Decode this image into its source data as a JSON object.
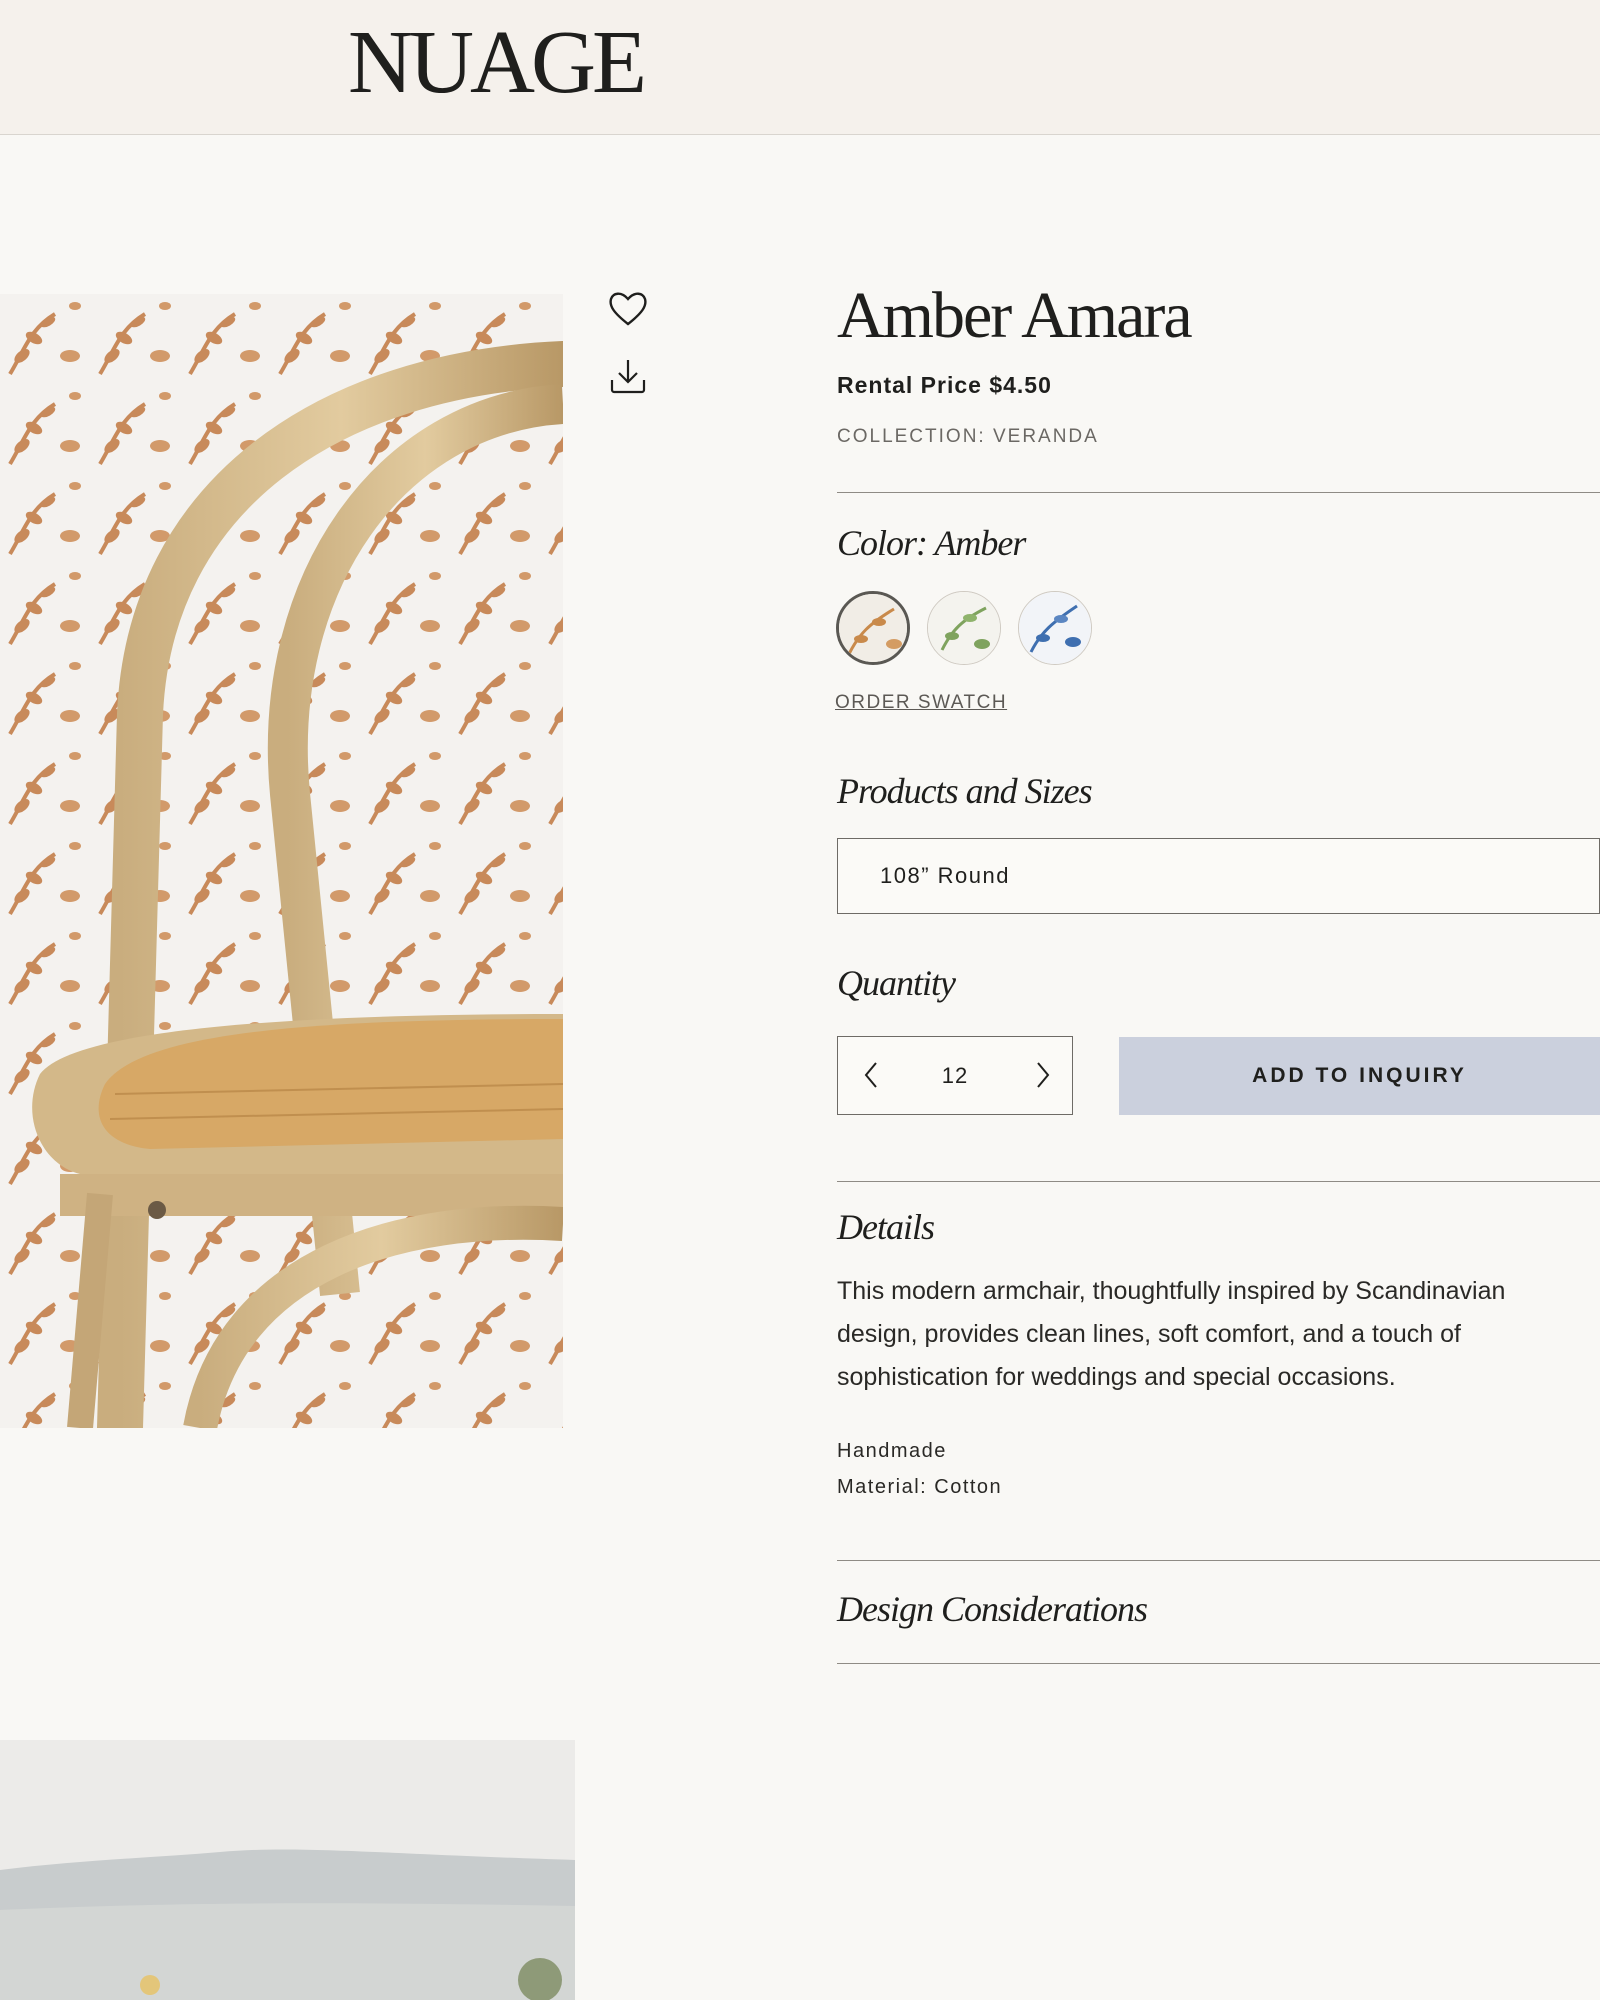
{
  "header": {
    "logo": "NUAGE"
  },
  "product": {
    "title": "Amber Amara",
    "price": "Rental Price $4.50",
    "collection": "COLLECTION: VERANDA"
  },
  "color": {
    "label": "Color: Amber",
    "swatches": [
      {
        "name": "Amber",
        "color": "#c98a4b",
        "selected": true
      },
      {
        "name": "Green",
        "color": "#7fa35e",
        "selected": false
      },
      {
        "name": "Blue",
        "color": "#3f6fb0",
        "selected": false
      }
    ],
    "order_swatch": "ORDER SWATCH"
  },
  "sizes": {
    "label": "Products and Sizes",
    "selected": "108”  Round"
  },
  "quantity": {
    "label": "Quantity",
    "value": "12",
    "add_button": "ADD TO INQUIRY"
  },
  "details": {
    "label": "Details",
    "description": "This modern armchair, thoughtfully inspired by Scandinavian design, provides clean lines, soft comfort, and a touch of sophistication for weddings and special occasions.",
    "handmade": "Handmade",
    "material": "Material: Cotton"
  },
  "design": {
    "label": "Design Considerations"
  },
  "icons": {
    "favorite": "heart-icon",
    "download": "download-icon"
  },
  "colors": {
    "accent_button": "#cbd0dd",
    "header_bg": "#f5f1ec",
    "page_bg": "#f9f8f5"
  }
}
